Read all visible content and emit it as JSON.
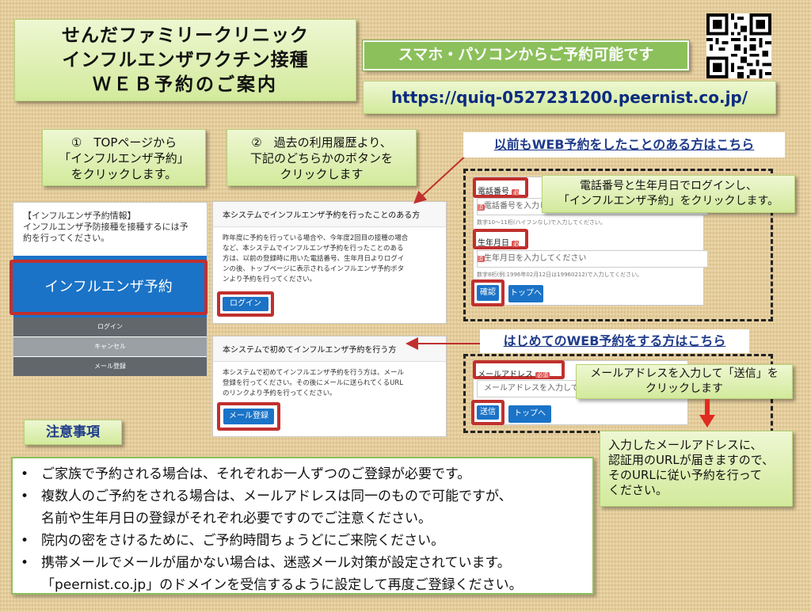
{
  "title_lines": [
    "せんだファミリークリニック",
    "インフルエンザワクチン接種",
    "ＷＥＢ予約のご案内"
  ],
  "banner": "スマホ・パソコンからご予約可能です",
  "url": "https://quiq-0527231200.peernist.co.jp/",
  "step1": {
    "lines": [
      "①　TOPページから",
      "「インフルエンザ予約」",
      "をクリックします。"
    ]
  },
  "step2": {
    "lines": [
      "②　過去の利用履歴より、",
      "下記のどちらかのボタンを",
      "クリックします"
    ]
  },
  "phone_screen": {
    "info_lines": [
      "【インフルエンザ予約情報】",
      "インフルエンザ予防接種を接種するには予",
      "約を行ってください。"
    ],
    "main_button": "インフルエンザ予約",
    "menu": [
      "ログイン",
      "キャンセル",
      "メール登録"
    ]
  },
  "existing_panel": {
    "heading": "本システムでインフルエンザ予約を行ったことのある方",
    "body_lines": [
      "昨年度に予約を行っている場合や、今年度2回目の接種の場合",
      "など、本システムでインフルエンザ予約を行ったことのある",
      "方は、以前の登録時に用いた電話番号、生年月日よりログイ",
      "ンの後、トップページに表示されるインフルエンザ予約ボタ",
      "ンより予約を行ってください。"
    ],
    "button": "ログイン"
  },
  "new_panel": {
    "heading": "本システムで初めてインフルエンザ予約を行う方",
    "body_lines": [
      "本システムで初めてインフルエンザ予約を行う方は、メール",
      "登録を行ってください。その後にメールに送られてくるURL",
      "のリンクより予約を行ってください。"
    ],
    "button": "メール登録"
  },
  "label_prev": "以前もWEB予約をしたことのある方はこちら",
  "label_first": "はじめてのWEB予約をする方はこちら",
  "login_form": {
    "phone_label": "電話番号",
    "required": "必須",
    "phone_placeholder": "電話番号を入力して",
    "phone_hint": "数字10～11桁(ハイフンなし)で入力してください。",
    "birth_label": "生年月日",
    "birth_placeholder": "生年月日を入力してください",
    "birth_hint": "数字8桁(例:1996年02月12日は19960212)で入力してください。",
    "confirm_button": "確認",
    "top_button": "トップへ"
  },
  "login_callout": [
    "電話番号と生年月日でログインし、",
    "「インフルエンザ予約」をクリックします。"
  ],
  "mail_form": {
    "label": "メールアドレス",
    "required": "必須",
    "placeholder": "メールアドレスを入力して",
    "send_button": "送信",
    "top_button": "トップへ"
  },
  "mail_callout": [
    "メールアドレスを入力して「送信」を",
    "クリックします"
  ],
  "after_callout": [
    "入力したメールアドレスに、",
    "認証用のURLが届きますので、",
    "そのURLに従い予約を行って",
    "ください。"
  ],
  "notes_title": "注意事項",
  "notes": [
    "ご家族で予約される場合は、それぞれお一人ずつのご登録が必要です。",
    "複数人のご予約をされる場合は、メールアドレスは同一のもので可能ですが、",
    "名前や生年月日の登録がそれぞれ必要ですのでご注意ください。",
    "院内の密をさけるために、ご予約時間ちょうどにご来院ください。",
    "携帯メールでメールが届かない場合は、迷惑メール対策が設定されています。",
    "「peernist.co.jp」のドメインを受信するように設定して再度ご登録ください。"
  ],
  "colors": {
    "accent_green": "#8cc05b",
    "button_blue": "#1b73c7",
    "highlight_red": "#c0302e",
    "url_navy": "#0b2a80"
  }
}
